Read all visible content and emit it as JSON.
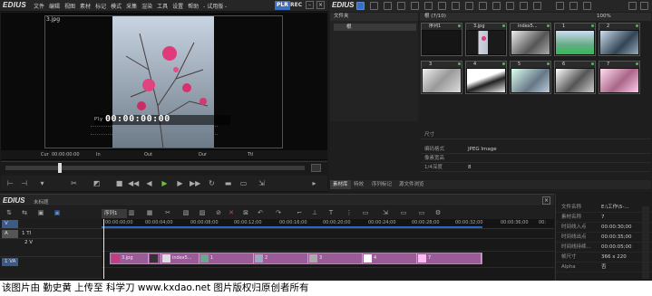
{
  "app": {
    "logo": "EDIUS",
    "mode": "- 试用版 -",
    "plr": "PLR",
    "rec": "REC"
  },
  "menu": [
    "文件",
    "编辑",
    "视图",
    "素材",
    "标记",
    "模式",
    "采集",
    "渲染",
    "工具",
    "设置",
    "帮助"
  ],
  "preview": {
    "clip_label": "3.jpg",
    "ply": "Ply",
    "timecode": "00:00:00:00",
    "inout": {
      "cur_label": "Cur",
      "cur": "00:00:00:00",
      "in_label": "In",
      "out_label": "Out",
      "dur_label": "Dur",
      "ttl_label": "Ttl"
    }
  },
  "bin": {
    "logo": "EDIUS",
    "folder_title": "文件夹",
    "folder_item": "根",
    "path": "根 (7/10)",
    "zoom": "100%",
    "thumbs": [
      {
        "label": "序列1",
        "colors": [
          "#1a1a1a",
          "#2a2a2a"
        ]
      },
      {
        "label": "3.jpg",
        "colors": [
          "#222",
          "#c83a7a"
        ]
      },
      {
        "label": "index5...",
        "colors": [
          "#ddd",
          "#444"
        ]
      },
      {
        "label": "1",
        "colors": [
          "#6a8",
          "#bcd"
        ]
      },
      {
        "label": "2",
        "colors": [
          "#9ab",
          "#234"
        ]
      },
      {
        "label": "3",
        "colors": [
          "#aaa",
          "#eee"
        ]
      },
      {
        "label": "4",
        "colors": [
          "#fff",
          "#222"
        ]
      },
      {
        "label": "5",
        "colors": [
          "#cfd",
          "#678"
        ]
      },
      {
        "label": "6",
        "colors": [
          "#eee",
          "#555"
        ]
      },
      {
        "label": "7",
        "colors": [
          "#fbe",
          "#a68"
        ]
      }
    ],
    "props": [
      {
        "key": "尺寸",
        "value": ""
      },
      {
        "key": "编码格式",
        "value": "JPEG Image"
      },
      {
        "key": "像素宽高",
        "value": ""
      },
      {
        "key": "1/4深度",
        "value": "8"
      }
    ],
    "tabs": [
      "素材库",
      "特效",
      "序列标记",
      "源文件浏览"
    ]
  },
  "timeline": {
    "logo": "EDIUS",
    "project": "未标题",
    "sequence_tab": "序列1",
    "ruler": [
      "00:00:00;00",
      "00:00:04;00",
      "00:00:08;00",
      "00:00:12;00",
      "00:00:16;00",
      "00:00:20;00",
      "00:00:24;00",
      "00:00:28;00",
      "00:00:32;00",
      "00:00:36;00",
      "00:"
    ],
    "tracks": [
      {
        "tag": "V",
        "name": ""
      },
      {
        "tag": "A",
        "name": "1 TI"
      },
      {
        "tag": "2 V",
        "name": ""
      },
      {
        "tag": "1 VA",
        "name": ""
      }
    ],
    "clips": [
      {
        "label": "3.jpg",
        "width": 42,
        "thumb": "#c83a7a"
      },
      {
        "label": "",
        "width": 14,
        "thumb": "#333"
      },
      {
        "label": "index5...",
        "width": 42,
        "thumb": "#ddd"
      },
      {
        "label": "1",
        "width": 60,
        "thumb": "#6a8"
      },
      {
        "label": "2",
        "width": 60,
        "thumb": "#9ab"
      },
      {
        "label": "3",
        "width": 60,
        "thumb": "#aaa"
      },
      {
        "label": "4",
        "width": 60,
        "thumb": "#fff"
      },
      {
        "label": "7",
        "width": 71,
        "thumb": "#fbe"
      }
    ]
  },
  "info": [
    {
      "key": "文件名称",
      "value": "E:\\工作\\5-..."
    },
    {
      "key": "素材名称",
      "value": "7"
    },
    {
      "key": "时间线入点",
      "value": "00:00:30;00"
    },
    {
      "key": "时间线出点",
      "value": "00:00:35;00"
    },
    {
      "key": "时间线持续...",
      "value": "00:00:05;00"
    },
    {
      "key": "帧尺寸",
      "value": "366 x 220"
    },
    {
      "key": "Alpha",
      "value": "否"
    }
  ],
  "caption": "该图片由 勤史黄 上传至 科学刀 www.kxdao.net 图片版权归原创者所有"
}
